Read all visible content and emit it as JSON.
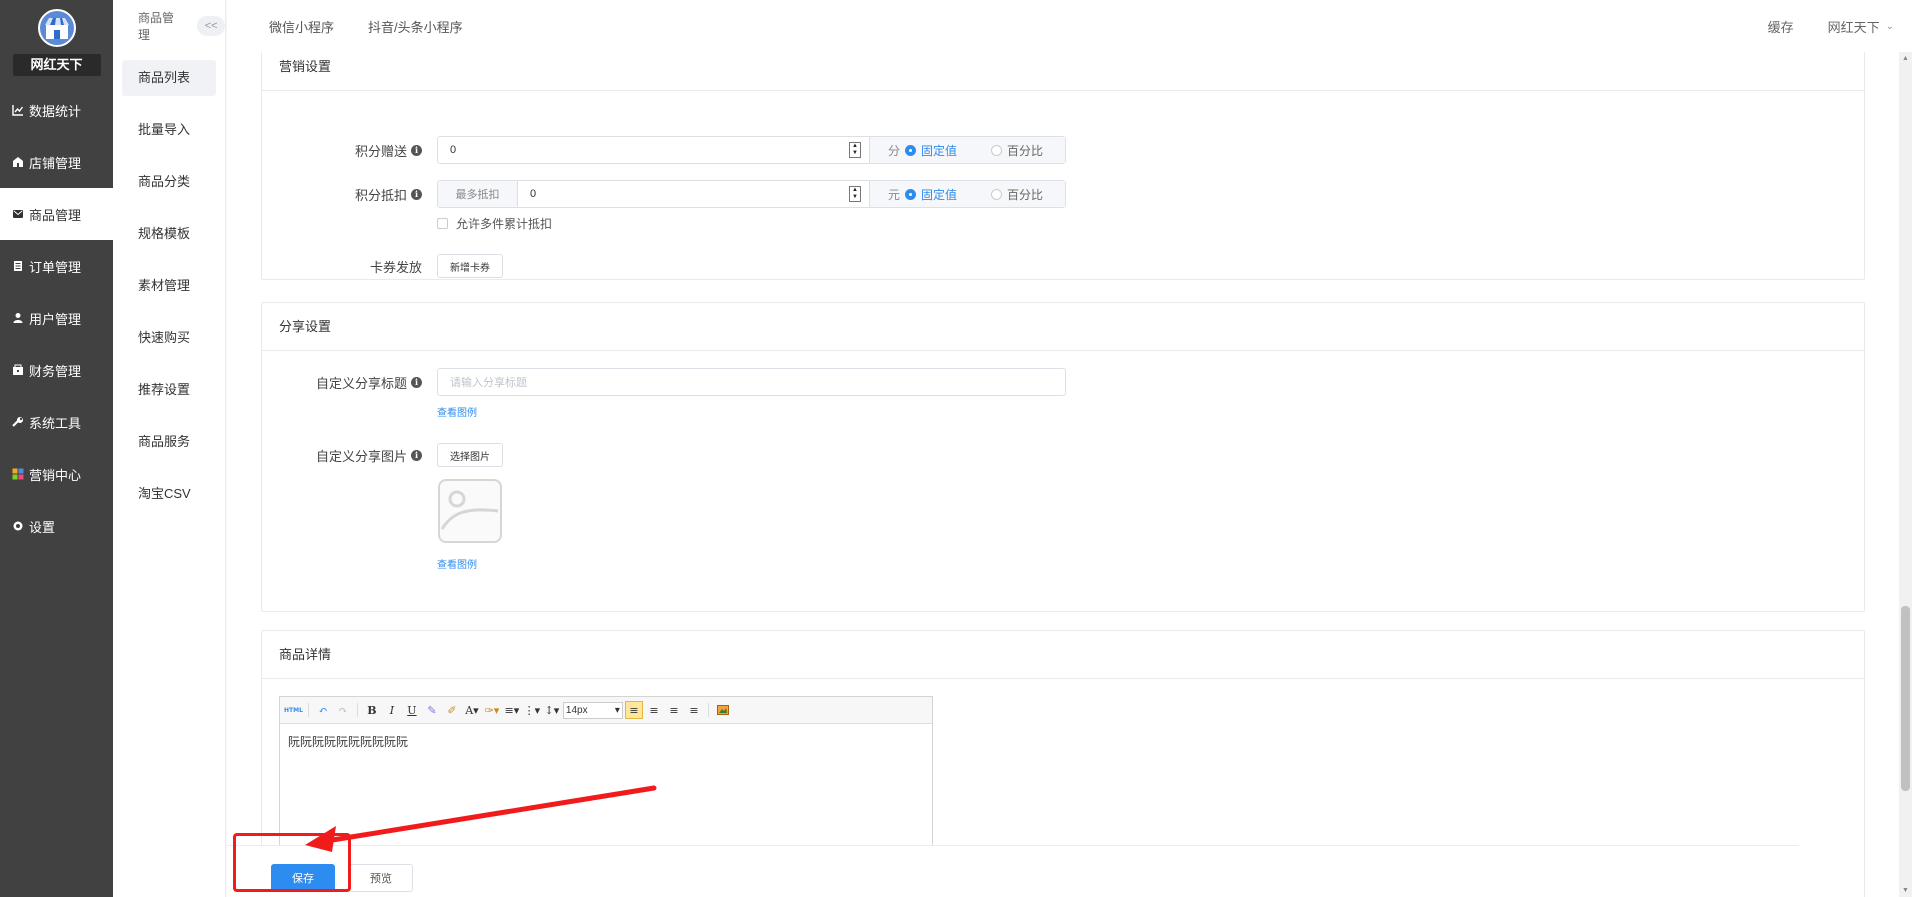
{
  "sidebar": {
    "store_name": "网红天下",
    "items": [
      {
        "label": "数据统计",
        "icon": "chart-line-icon"
      },
      {
        "label": "店铺管理",
        "icon": "store-icon"
      },
      {
        "label": "商品管理",
        "icon": "product-icon"
      },
      {
        "label": "订单管理",
        "icon": "order-icon"
      },
      {
        "label": "用户管理",
        "icon": "user-icon"
      },
      {
        "label": "财务管理",
        "icon": "finance-icon"
      },
      {
        "label": "系统工具",
        "icon": "wrench-icon"
      },
      {
        "label": "营销中心",
        "icon": "marketing-icon"
      },
      {
        "label": "设置",
        "icon": "settings-icon"
      }
    ],
    "active_index": 2
  },
  "submenu": {
    "title": "商品管理",
    "collapse_label": "<<",
    "items": [
      "商品列表",
      "批量导入",
      "商品分类",
      "规格模板",
      "素材管理",
      "快速购买",
      "推荐设置",
      "商品服务",
      "淘宝CSV"
    ],
    "active_index": 0
  },
  "topbar": {
    "tabs": [
      "微信小程序",
      "抖音/头条小程序"
    ],
    "cache_label": "缓存",
    "user_name": "网红天下"
  },
  "marketing": {
    "title": "营销设置",
    "points_gift": {
      "label": "积分赠送",
      "value": "0",
      "unit": "分",
      "option_fixed": "固定值",
      "option_percent": "百分比",
      "selected": "固定值"
    },
    "points_deduct": {
      "label": "积分抵扣",
      "prefix": "最多抵扣",
      "value": "0",
      "unit": "元",
      "option_fixed": "固定值",
      "option_percent": "百分比",
      "selected": "固定值"
    },
    "allow_multi_label": "允许多件累计抵扣",
    "coupon": {
      "label": "卡券发放",
      "button": "新增卡券"
    }
  },
  "share": {
    "title": "分享设置",
    "custom_title": {
      "label": "自定义分享标题",
      "placeholder": "请输入分享标题",
      "example_link": "查看图例"
    },
    "custom_image": {
      "label": "自定义分享图片",
      "button": "选择图片",
      "example_link": "查看图例"
    }
  },
  "detail": {
    "title": "商品详情",
    "font_size": "14px",
    "content": "阮阮阮阮阮阮阮阮阮阮"
  },
  "footer": {
    "save": "保存",
    "preview": "预览"
  },
  "colors": {
    "primary": "#2d8cf0",
    "sidebar_bg": "#414141",
    "annotation": "#f21b1b"
  }
}
